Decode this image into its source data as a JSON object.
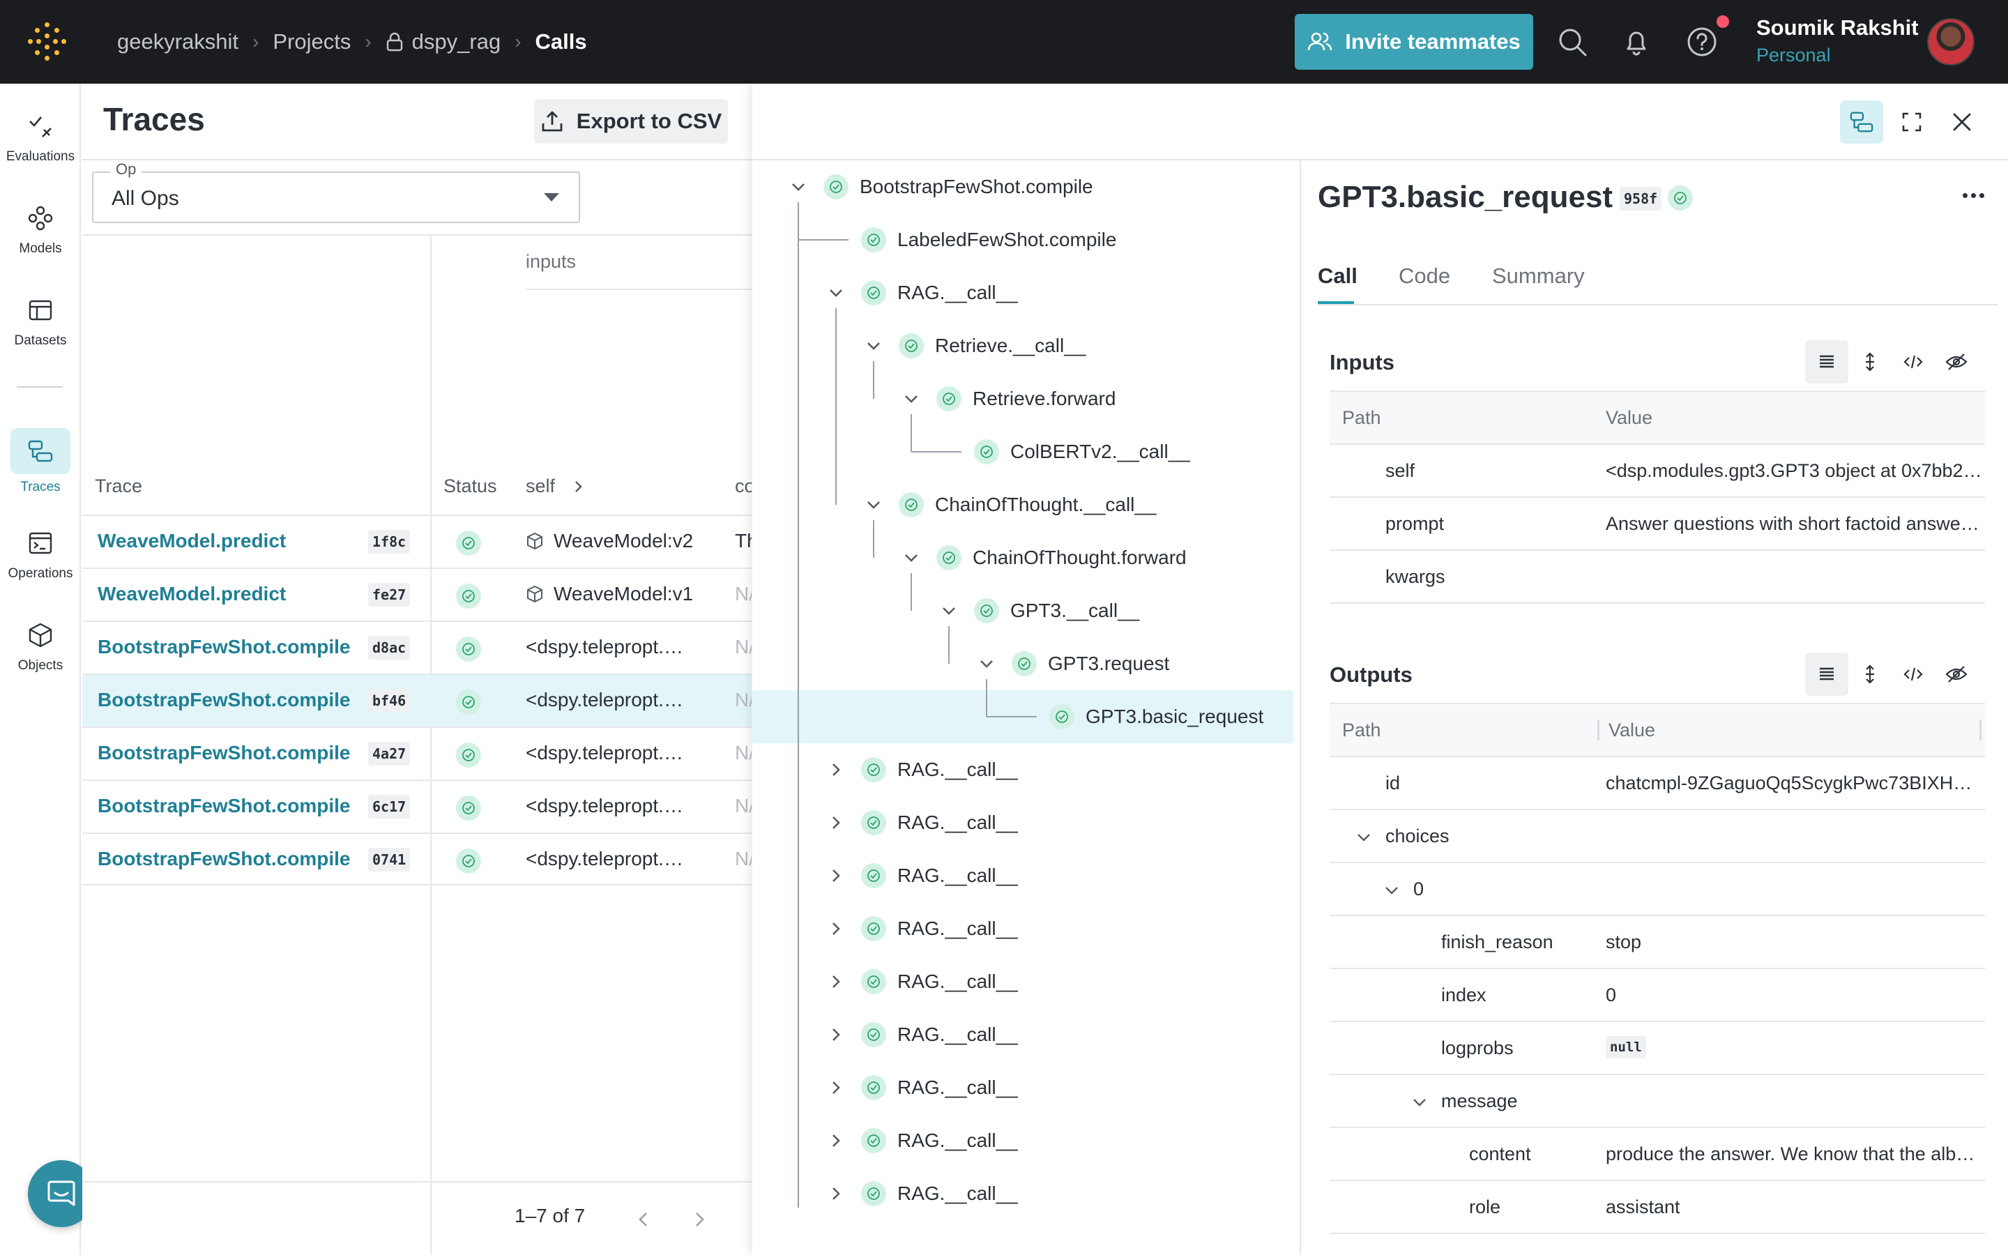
{
  "colors": {
    "accent": "#3ba3b5",
    "link": "#1f7f95",
    "topbar": "#1a1c1f",
    "success_bg": "#d2f1e4",
    "success": "#2ea46f",
    "selected_row": "#e3f5f8"
  },
  "header": {
    "breadcrumb": [
      "geekyrakshit",
      "Projects",
      "dspy_rag",
      "Calls"
    ],
    "invite_label": "Invite teammates",
    "user_name": "Soumik Rakshit",
    "user_sub": "Personal"
  },
  "nav": {
    "items": [
      {
        "label": "Evaluations",
        "icon": "evaluations-icon"
      },
      {
        "label": "Models",
        "icon": "models-icon"
      },
      {
        "label": "Datasets",
        "icon": "datasets-icon"
      },
      {
        "label": "Traces",
        "icon": "traces-icon",
        "active": true
      },
      {
        "label": "Operations",
        "icon": "operations-icon"
      },
      {
        "label": "Objects",
        "icon": "objects-icon"
      }
    ]
  },
  "traces": {
    "title": "Traces",
    "export_label": "Export to CSV",
    "op_filter": {
      "legend": "Op",
      "value": "All Ops"
    },
    "group_header": "inputs",
    "columns": {
      "trace": "Trace",
      "status": "Status",
      "self": "self",
      "c": "co"
    },
    "rows": [
      {
        "op": "WeaveModel.predict",
        "hash": "1f8c",
        "self": "WeaveModel:v2",
        "c": "Th",
        "c_dark": true,
        "self_icon": true
      },
      {
        "op": "WeaveModel.predict",
        "hash": "fe27",
        "self": "WeaveModel:v1",
        "c": "N/",
        "self_icon": true
      },
      {
        "op": "BootstrapFewShot.compile",
        "hash": "d8ac",
        "self": "<dspy.telepropt.…",
        "c": "N/"
      },
      {
        "op": "BootstrapFewShot.compile",
        "hash": "bf46",
        "self": "<dspy.telepropt.…",
        "c": "N/",
        "selected": true
      },
      {
        "op": "BootstrapFewShot.compile",
        "hash": "4a27",
        "self": "<dspy.telepropt.…",
        "c": "N/"
      },
      {
        "op": "BootstrapFewShot.compile",
        "hash": "6c17",
        "self": "<dspy.telepropt.…",
        "c": "N/"
      },
      {
        "op": "BootstrapFewShot.compile",
        "hash": "0741",
        "self": "<dspy.telepropt.…",
        "c": "N/"
      }
    ],
    "pager": "1–7 of 7"
  },
  "tree": {
    "nodes": [
      {
        "label": "BootstrapFewShot.compile",
        "depth": 0,
        "chev": "down"
      },
      {
        "label": "LabeledFewShot.compile",
        "depth": 1,
        "chev": "none"
      },
      {
        "label": "RAG.__call__",
        "depth": 1,
        "chev": "down"
      },
      {
        "label": "Retrieve.__call__",
        "depth": 2,
        "chev": "down"
      },
      {
        "label": "Retrieve.forward",
        "depth": 3,
        "chev": "down"
      },
      {
        "label": "ColBERTv2.__call__",
        "depth": 4,
        "chev": "none"
      },
      {
        "label": "ChainOfThought.__call__",
        "depth": 2,
        "chev": "down"
      },
      {
        "label": "ChainOfThought.forward",
        "depth": 3,
        "chev": "down"
      },
      {
        "label": "GPT3.__call__",
        "depth": 4,
        "chev": "down"
      },
      {
        "label": "GPT3.request",
        "depth": 5,
        "chev": "down"
      },
      {
        "label": "GPT3.basic_request",
        "depth": 6,
        "chev": "none",
        "selected": true
      },
      {
        "label": "RAG.__call__",
        "depth": 1,
        "chev": "right"
      },
      {
        "label": "RAG.__call__",
        "depth": 1,
        "chev": "right"
      },
      {
        "label": "RAG.__call__",
        "depth": 1,
        "chev": "right"
      },
      {
        "label": "RAG.__call__",
        "depth": 1,
        "chev": "right"
      },
      {
        "label": "RAG.__call__",
        "depth": 1,
        "chev": "right"
      },
      {
        "label": "RAG.__call__",
        "depth": 1,
        "chev": "right"
      },
      {
        "label": "RAG.__call__",
        "depth": 1,
        "chev": "right"
      },
      {
        "label": "RAG.__call__",
        "depth": 1,
        "chev": "right"
      },
      {
        "label": "RAG.__call__",
        "depth": 1,
        "chev": "right"
      }
    ]
  },
  "details": {
    "title": "GPT3.basic_request",
    "hash": "958f",
    "tabs": [
      "Call",
      "Code",
      "Summary"
    ],
    "active_tab": "Call",
    "inputs": {
      "title": "Inputs",
      "col_path": "Path",
      "col_value": "Value",
      "rows": [
        {
          "key": "self",
          "value": "<dsp.modules.gpt3.GPT3 object at 0x7bb2…"
        },
        {
          "key": "prompt",
          "value": "Answer questions with short factoid answe…"
        },
        {
          "key": "kwargs",
          "value": ""
        }
      ]
    },
    "outputs": {
      "title": "Outputs",
      "col_path": "Path",
      "col_value": "Value",
      "rows": [
        {
          "key": "id",
          "value": "chatcmpl-9ZGaguoQq5ScygkPwc73BIXHTt…",
          "level": 0
        },
        {
          "key": "choices",
          "value": "",
          "level": 0,
          "toggle": true
        },
        {
          "key": "0",
          "value": "",
          "level": 1,
          "toggle": true
        },
        {
          "key": "finish_reason",
          "value": "stop",
          "level": 2
        },
        {
          "key": "index",
          "value": "0",
          "level": 2
        },
        {
          "key": "logprobs",
          "value": "null",
          "level": 2,
          "null": true
        },
        {
          "key": "message",
          "value": "",
          "level": 2,
          "toggle": true
        },
        {
          "key": "content",
          "value": "produce the answer. We know that the alb…",
          "level": 3
        },
        {
          "key": "role",
          "value": "assistant",
          "level": 3
        }
      ]
    }
  }
}
